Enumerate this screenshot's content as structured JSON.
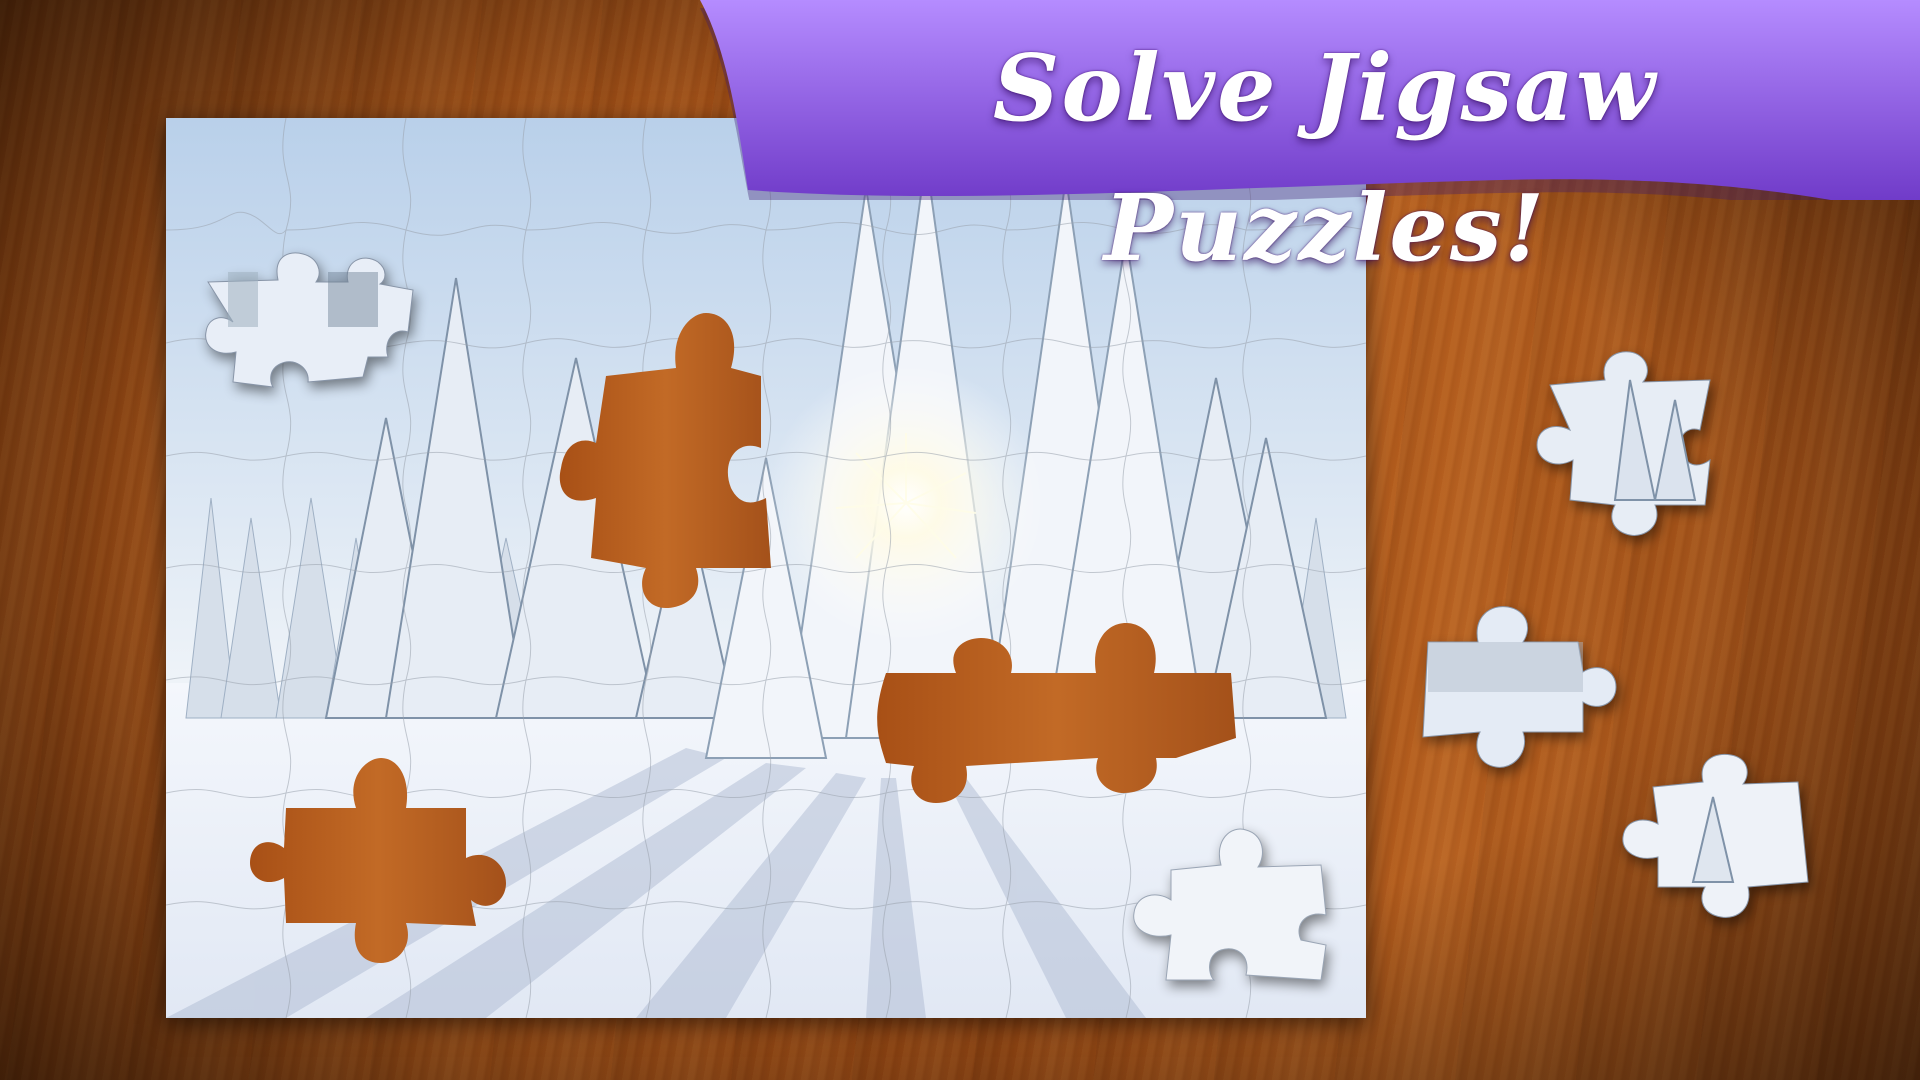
{
  "banner": {
    "title": "Solve Jigsaw Puzzles!",
    "gradient_top": "#b58cff",
    "gradient_bottom": "#6a34c4"
  },
  "board": {
    "image": "snowy-forest-sunrise",
    "grid_cols": 10,
    "grid_rows": 8,
    "sky_color": "#cfe0f2",
    "snow_color": "#eef3fb",
    "wood_color": "#b0591c"
  },
  "loose_pieces_count": 5,
  "holes_count": 3
}
